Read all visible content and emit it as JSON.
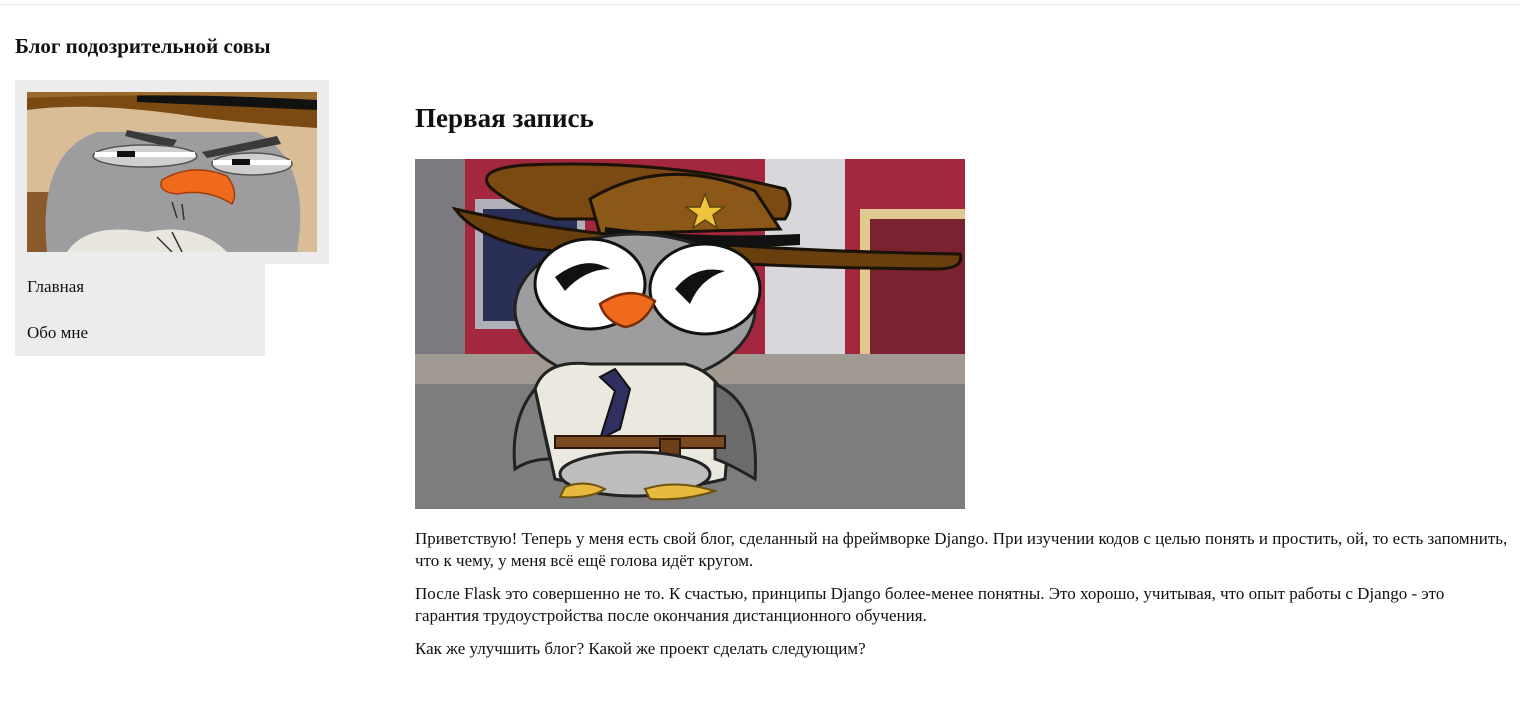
{
  "header": {
    "site_title": "Блог подозрительной совы"
  },
  "sidebar": {
    "avatar_icon": "suspicious-owl-avatar",
    "nav": [
      {
        "label": "Главная"
      },
      {
        "label": "Обо мне"
      }
    ]
  },
  "post": {
    "title": "Первая запись",
    "image_icon": "sheriff-owl-illustration",
    "paragraphs": [
      "Приветствую! Теперь у меня есть свой блог, сделанный на фреймворке Django. При изучении кодов с целью понять и простить, ой, то есть запомнить, что к чему, у меня всё ещё голова идёт кругом.",
      "После Flask это совершенно не то. К счастью, принципы Django более-менее понятны. Это хорошо, учитывая, что опыт работы с Django - это гарантия трудоустройства после окончания дистанционного обучения.",
      "Как же улучшить блог? Какой же проект сделать следующим?"
    ]
  },
  "colors": {
    "panel_bg": "#ececec",
    "text": "#111111"
  }
}
